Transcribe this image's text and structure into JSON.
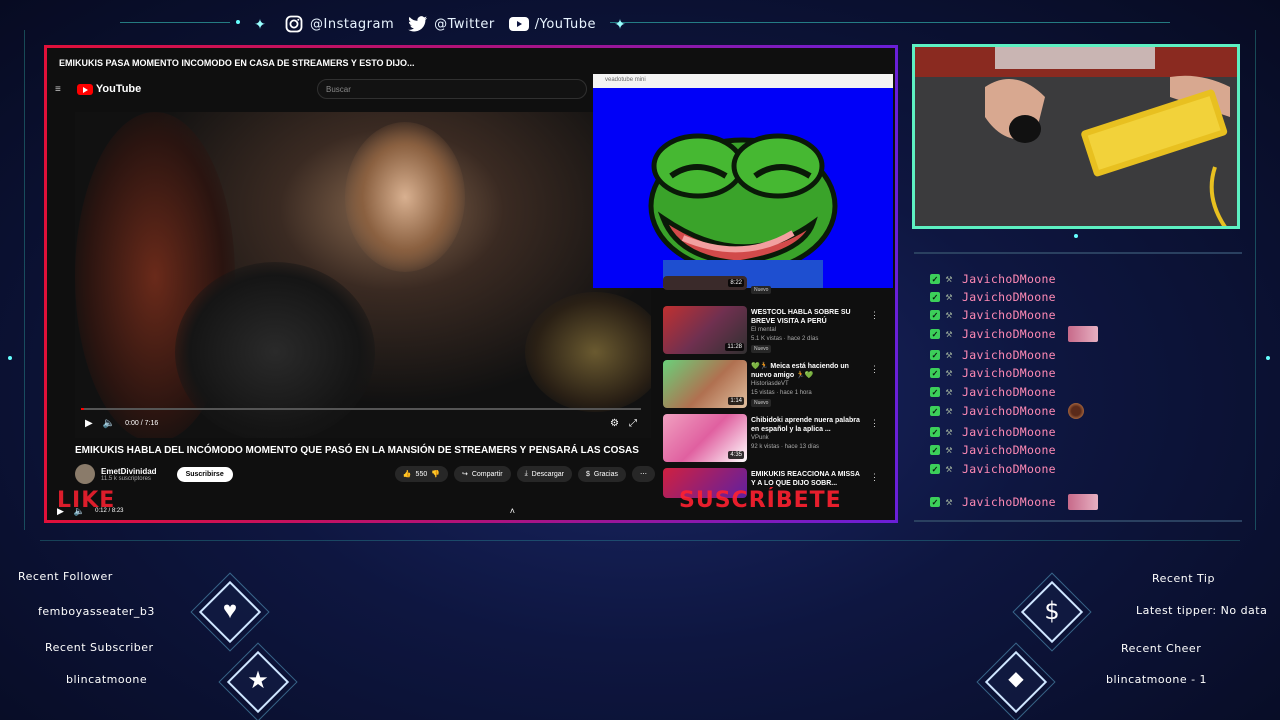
{
  "social": {
    "instagram": "@Instagram",
    "twitter": "@Twitter",
    "youtube": "/YouTube"
  },
  "capture": {
    "window_title": "EMIKUKIS PASA MOMENTO INCOMODO EN CASA DE STREAMERS Y ESTO DIJO...",
    "yt_brand": "YouTube",
    "search_placeholder": "Buscar",
    "video_time": "0:00 / 7:16",
    "video_title": "EMIKUKIS HABLA DEL INCÓMODO MOMENTO QUE PASÓ EN LA MANSIÓN DE STREAMERS Y PENSARÁ LAS COSAS",
    "channel_name": "EmetDivinidad",
    "channel_subs": "11.5 k suscriptores",
    "subscribe_label": "Suscribirse",
    "likes": "550",
    "share_label": "Compartir",
    "download_label": "Descargar",
    "thanks_label": "Gracias",
    "outer_time": "0:12 / 8:23",
    "like_overlay": "LIKE",
    "subscribe_overlay": "SUSCRÍBETE",
    "pepe_window_title": "veadotube mini",
    "progress": 0.005
  },
  "related": [
    {
      "title": "",
      "meta1": "",
      "meta2": "",
      "badge": "Nuevo",
      "duration": "8:22"
    },
    {
      "title": "WESTCOL HABLA SOBRE SU BREVE VISITA A PERÚ",
      "meta1": "El mental",
      "meta2": "5.1 K vistas · hace 2 días",
      "badge": "Nuevo",
      "duration": "11:28"
    },
    {
      "title": "💚🏃 Meica está haciendo un nuevo amigo 🏃💚",
      "meta1": "HistoriasdeVT",
      "meta2": "15 vistas · hace 1 hora",
      "badge": "Nuevo",
      "duration": "1:14"
    },
    {
      "title": "Chibidoki aprende nuera palabra en español y la aplica ...",
      "meta1": "VPunk",
      "meta2": "92 k vistas · hace 13 días",
      "badge": "",
      "duration": "4:35"
    },
    {
      "title": "EMIKUKIS REACCIONA A MISSA Y A LO QUE DIJO SOBR...",
      "meta1": "",
      "meta2": "",
      "badge": "",
      "duration": ""
    }
  ],
  "chat": {
    "messages": [
      {
        "name": "JavichoDMoone",
        "emote": ""
      },
      {
        "name": "JavichoDMoone",
        "emote": ""
      },
      {
        "name": "JavichoDMoone",
        "emote": ""
      },
      {
        "name": "JavichoDMoone",
        "emote": "square"
      },
      {
        "name": "JavichoDMoone",
        "emote": ""
      },
      {
        "name": "JavichoDMoone",
        "emote": ""
      },
      {
        "name": "JavichoDMoone",
        "emote": ""
      },
      {
        "name": "JavichoDMoone",
        "emote": "round"
      },
      {
        "name": "JavichoDMoone",
        "emote": ""
      },
      {
        "name": "JavichoDMoone",
        "emote": ""
      },
      {
        "name": "JavichoDMoone",
        "emote": ""
      },
      {
        "name": "JavichoDMoone",
        "emote": "square"
      }
    ]
  },
  "alerts": {
    "recent_follower_label": "Recent Follower",
    "recent_follower": "femboyasseater_b3",
    "recent_subscriber_label": "Recent Subscriber",
    "recent_subscriber": "blincatmoone",
    "recent_tip_label": "Recent Tip",
    "recent_tip": "Latest tipper: No data",
    "recent_cheer_label": "Recent Cheer",
    "recent_cheer": "blincatmoone - 1"
  },
  "colors": {
    "accent_teal": "#3ad6c8",
    "chat_name": "#ff8ab5",
    "cam_border": "#5df0c2",
    "capture_border_start": "#e0103a",
    "capture_border_end": "#6a1fd8"
  }
}
